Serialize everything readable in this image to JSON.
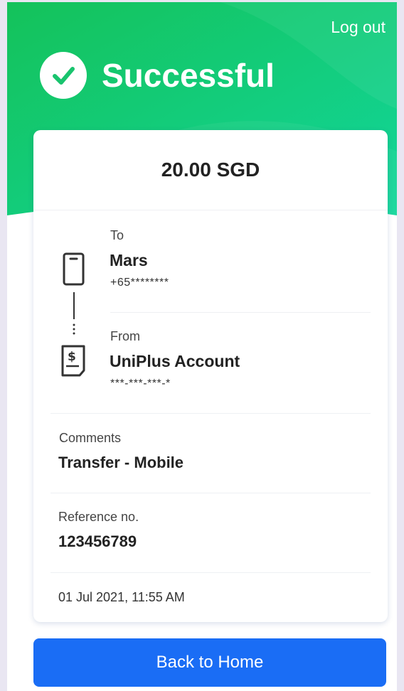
{
  "header": {
    "logout_label": "Log out",
    "status_title": "Successful",
    "status_icon": "check-circle-icon",
    "accent_color": "#19c46e"
  },
  "transfer": {
    "amount": "20.00 SGD",
    "to": {
      "label": "To",
      "name": "Mars",
      "number": "+65********",
      "icon": "mobile-phone-icon"
    },
    "from": {
      "label": "From",
      "name": "UniPlus Account",
      "number": "***-***-***-*",
      "icon": "account-document-icon"
    },
    "comments": {
      "label": "Comments",
      "value": "Transfer - Mobile"
    },
    "reference": {
      "label": "Reference no.",
      "value": "123456789"
    },
    "datetime": "01 Jul 2021, 11:55 AM"
  },
  "actions": {
    "back_home_label": "Back to Home",
    "button_color": "#1a6df5"
  }
}
